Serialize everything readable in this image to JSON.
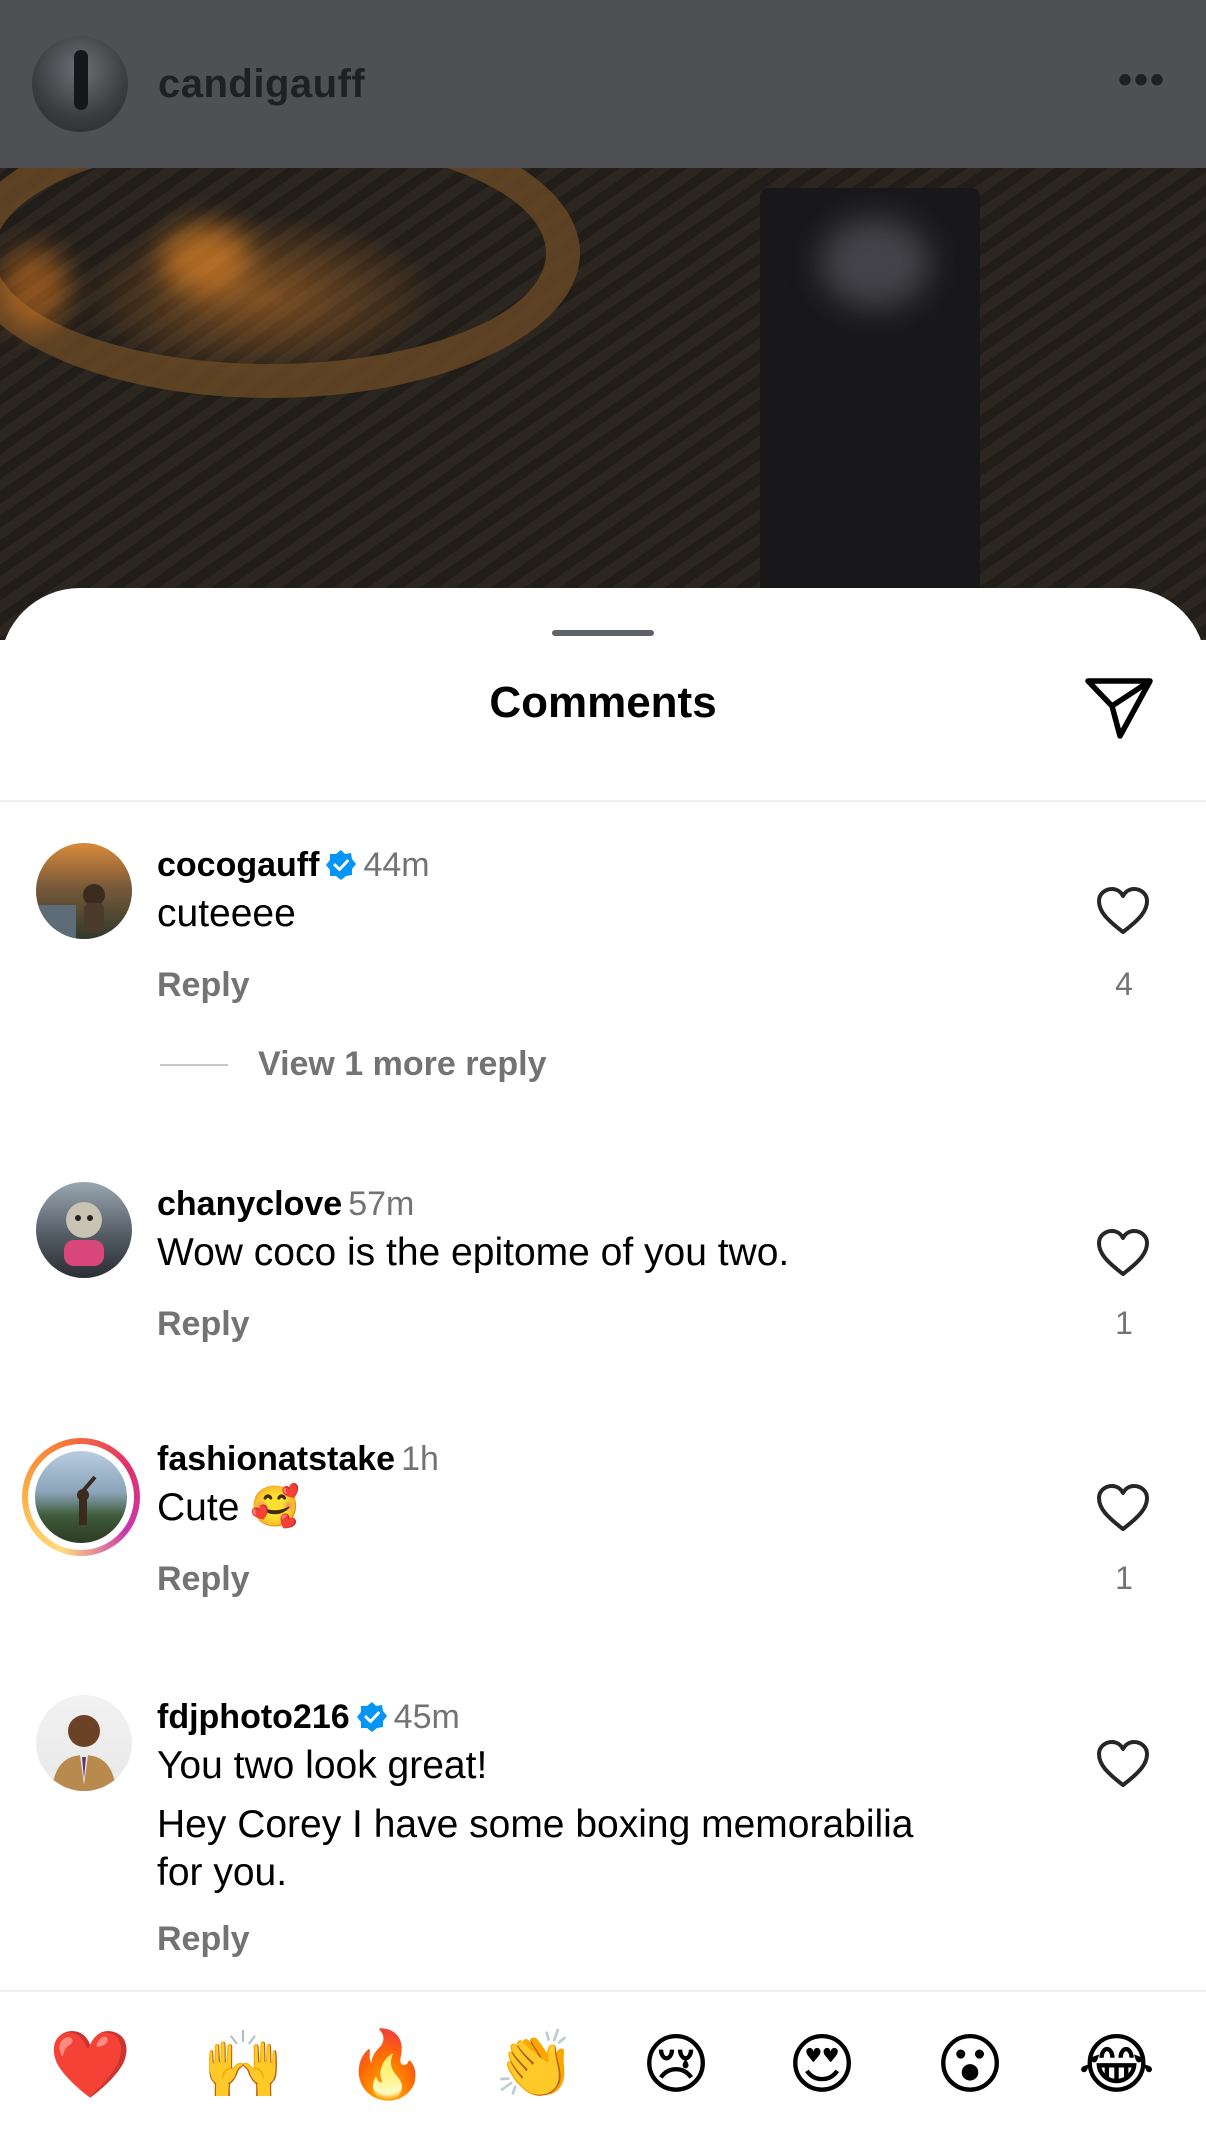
{
  "post": {
    "username": "candigauff",
    "more_label": "•••"
  },
  "sheet": {
    "title": "Comments"
  },
  "comments": [
    {
      "username": "cocogauff",
      "verified": true,
      "time": "44m",
      "text": "cuteeee",
      "reply_label": "Reply",
      "likes": "4"
    },
    {
      "username": "chanyclove",
      "verified": false,
      "time": "57m",
      "text": "Wow coco is the epitome of you two.",
      "reply_label": "Reply",
      "likes": "1"
    },
    {
      "username": "fashionatstake",
      "verified": false,
      "time": "1h",
      "text": "Cute",
      "reply_label": "Reply",
      "likes": "1"
    },
    {
      "username": "fdjphoto216",
      "verified": true,
      "time": "45m",
      "text_line1": "You two look great!",
      "text_line2": "Hey Corey I have some boxing memorabilia",
      "text_line3": "for you.",
      "reply_label": "Reply"
    }
  ],
  "view_more_replies": "View 1 more reply",
  "emoji_bar": [
    "❤️",
    "🙌",
    "🔥",
    "👏",
    "😢",
    "😍",
    "😮",
    "😂"
  ],
  "colors": {
    "verified": "#0095f6",
    "secondary_text": "#737373",
    "story_ring_start": "#c837ab",
    "story_ring_end": "#ffdc80"
  }
}
